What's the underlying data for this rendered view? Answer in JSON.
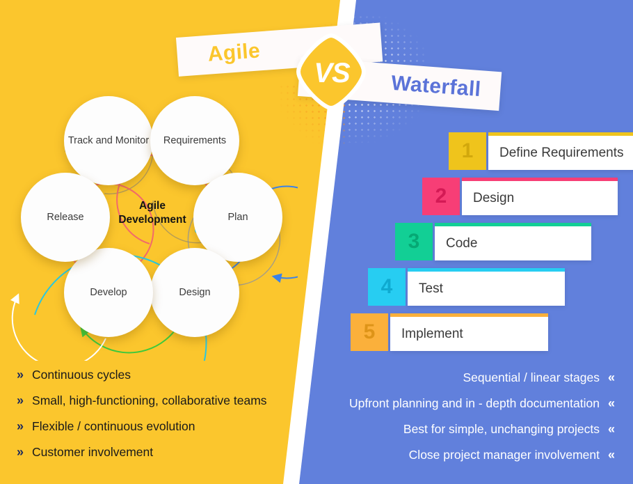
{
  "header": {
    "left_banner": "Agile",
    "right_banner": "Waterfall",
    "vs_badge": "VS"
  },
  "agile": {
    "center_label_line1": "Agile",
    "center_label_line2": "Development",
    "nodes": [
      {
        "label": "Track and Monitor",
        "arc_color": "#F26A6A",
        "marker": "dot"
      },
      {
        "label": "Requirements",
        "arc_color": "#F26A6A",
        "marker": "arrow"
      },
      {
        "label": "Plan",
        "arc_color": "#3B82E8",
        "marker": "arrow"
      },
      {
        "label": "Design",
        "arc_color": "#29C7E0",
        "marker": "arrow"
      },
      {
        "label": "Develop",
        "arc_color": "#3CC93C",
        "marker": "arrow"
      },
      {
        "label": "Release",
        "arc_color": "#FFFFFF",
        "marker": "arrow"
      }
    ]
  },
  "waterfall": {
    "steps": [
      {
        "number": "1",
        "label": "Define Requirements",
        "color": "#EFC41C",
        "number_color": "#D2A80C"
      },
      {
        "number": "2",
        "label": "Design",
        "color": "#F73E76",
        "number_color": "#D41A55"
      },
      {
        "number": "3",
        "label": "Code",
        "color": "#12CF95",
        "number_color": "#06A874"
      },
      {
        "number": "4",
        "label": "Test",
        "color": "#27CDF2",
        "number_color": "#0FAAD0"
      },
      {
        "number": "5",
        "label": "Implement",
        "color": "#FBB03B",
        "number_color": "#DE9418"
      }
    ]
  },
  "agile_bullets": {
    "chevron": "»",
    "items": [
      "Continuous cycles",
      "Small, high-functioning, collaborative teams",
      "Flexible / continuous evolution",
      "Customer involvement"
    ]
  },
  "waterfall_bullets": {
    "chevron": "«",
    "items": [
      "Sequential  / linear stages",
      "Upfront planning and in - depth documentation",
      "Best for simple, unchanging projects",
      "Close project manager involvement"
    ]
  },
  "colors": {
    "yellow_panel": "#FBC62D",
    "blue_panel": "#6180DC",
    "divider": "#FFFFFF",
    "agile_title": "#FBC62D",
    "waterfall_title": "#5B73D8"
  }
}
